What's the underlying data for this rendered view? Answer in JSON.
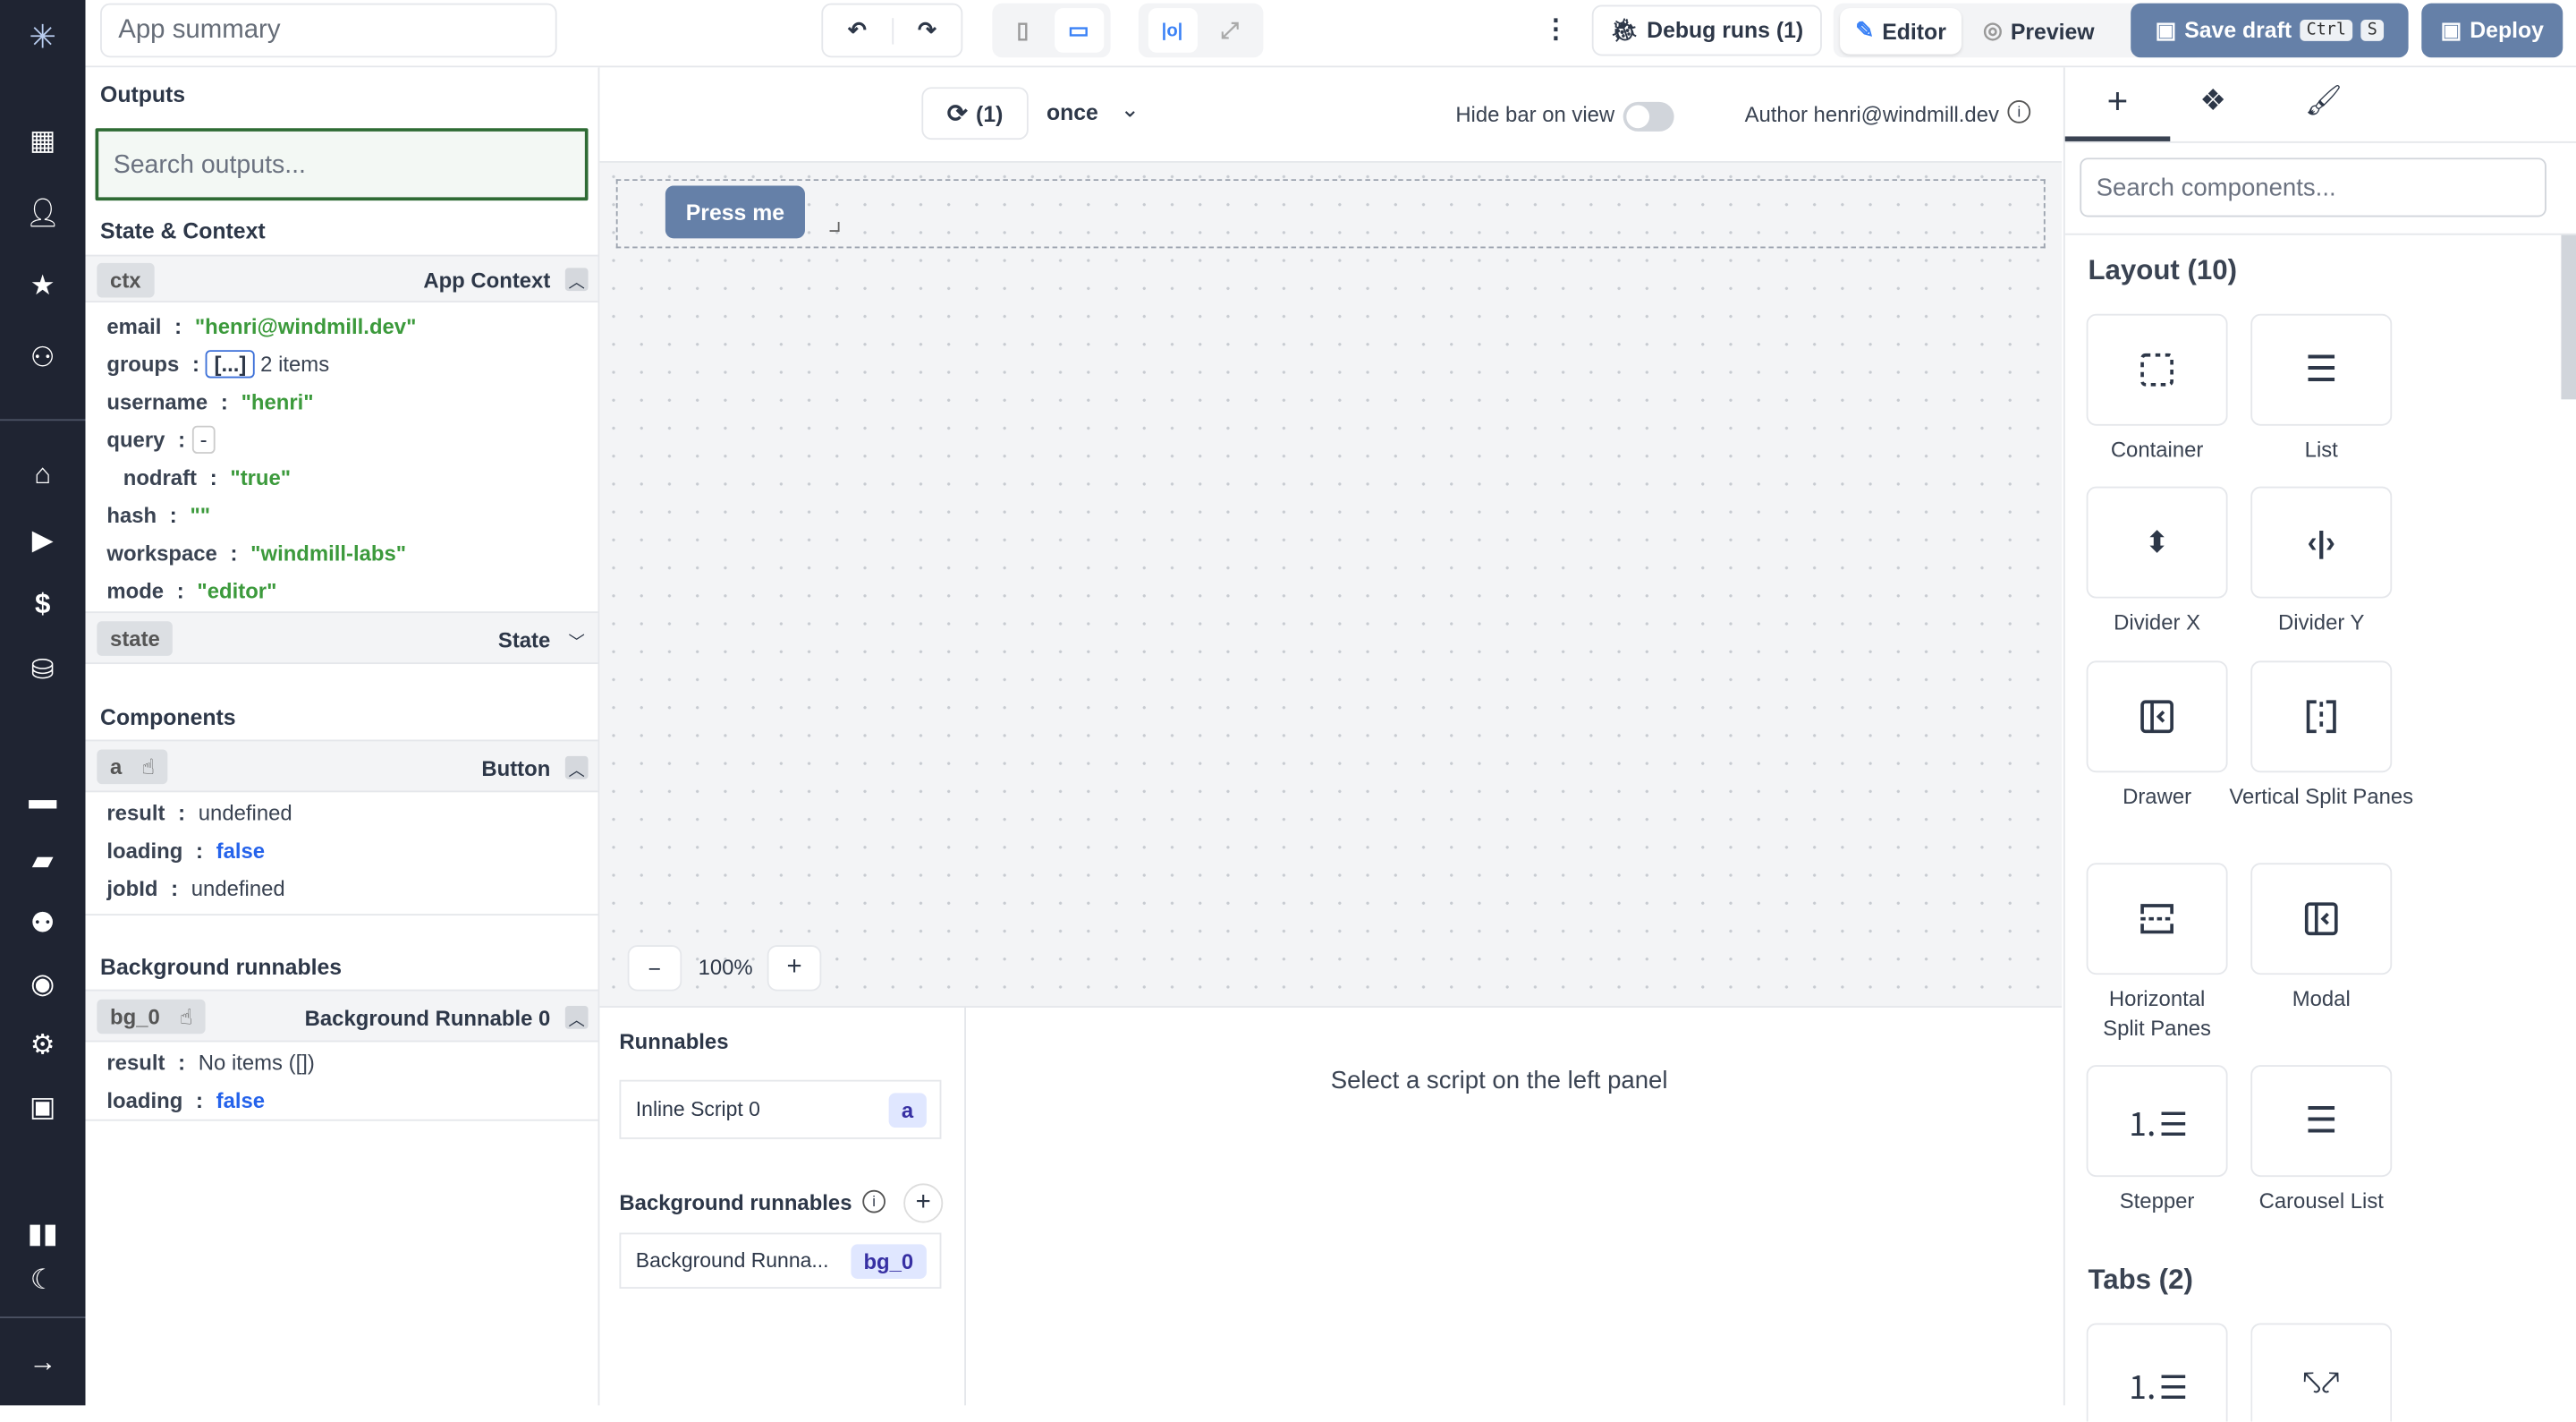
{
  "topbar": {
    "app_title": "App summary",
    "debug_runs": "Debug runs (1)",
    "editor": "Editor",
    "preview": "Preview",
    "save_draft": "Save draft",
    "kbd_ctrl": "Ctrl",
    "kbd_s": "S",
    "deploy": "Deploy"
  },
  "outputs": {
    "title": "Outputs",
    "search_placeholder": "Search outputs...",
    "state_context": "State & Context",
    "ctx": {
      "tag": "ctx",
      "title": "App Context",
      "rows": [
        {
          "key": "email",
          "value": "\"henri@windmill.dev\""
        },
        {
          "key": "groups",
          "value": "[...]",
          "extra": "2 items"
        },
        {
          "key": "username",
          "value": "\"henri\""
        },
        {
          "key": "query",
          "value": "-"
        },
        {
          "key": "nodraft",
          "value": "\"true\""
        },
        {
          "key": "hash",
          "value": "\"\""
        },
        {
          "key": "workspace",
          "value": "\"windmill-labs\""
        },
        {
          "key": "mode",
          "value": "\"editor\""
        }
      ]
    },
    "state": {
      "tag": "state",
      "title": "State"
    },
    "components_title": "Components",
    "component": {
      "tag": "a",
      "title": "Button",
      "rows": [
        {
          "key": "result",
          "value": "undefined"
        },
        {
          "key": "loading",
          "value": "false"
        },
        {
          "key": "jobId",
          "value": "undefined"
        }
      ]
    },
    "bg_title": "Background runnables",
    "bg": {
      "tag": "bg_0",
      "title": "Background Runnable 0",
      "rows": [
        {
          "key": "result",
          "value": "No items ([])"
        },
        {
          "key": "loading",
          "value": "false"
        }
      ]
    }
  },
  "center": {
    "refresh_count": "(1)",
    "run_mode": "once",
    "hide_bar": "Hide bar on view",
    "hide_bar_on": false,
    "author": "Author henri@windmill.dev",
    "press_me": "Press me",
    "zoom": "100%",
    "runnables_title": "Runnables",
    "inline_script": "Inline Script 0",
    "inline_badge": "a",
    "bg_runnables_title": "Background runnables",
    "bg_item": "Background Runna...",
    "bg_badge": "bg_0",
    "empty": "Select a script on the left panel"
  },
  "right": {
    "search_placeholder": "Search components...",
    "layout_title": "Layout (10)",
    "tabs_title": "Tabs (2)",
    "components": [
      "Container",
      "List",
      "Divider X",
      "Divider Y",
      "Drawer",
      "Vertical Split Panes",
      "Horizontal Split Panes",
      "Modal",
      "Stepper",
      "Carousel List"
    ]
  },
  "colors": {
    "sidebar": "#1f2432",
    "primary": "#6580a8",
    "string": "#3c9a3c",
    "boolean": "#2563eb",
    "focus": "#2e6b34"
  }
}
